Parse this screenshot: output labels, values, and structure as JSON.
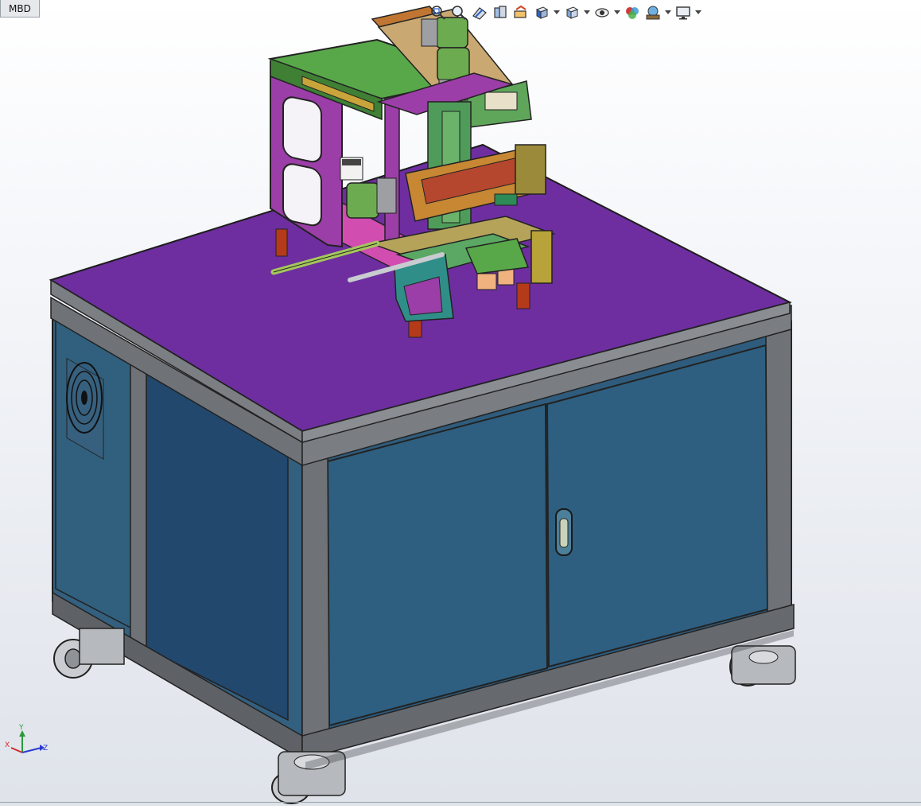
{
  "tabs": {
    "mbd_label": "MBD"
  },
  "toolbar": {
    "buttons": [
      "zoom-to-fit-icon",
      "zoom-to-area-icon",
      "previous-view-icon",
      "section-view-icon",
      "dynamic-annotation-icon",
      "view-orientation-icon",
      "display-style-icon",
      "hide-show-items-icon",
      "edit-appearance-icon",
      "apply-scene-icon",
      "view-settings-icon"
    ]
  },
  "triad": {
    "x_label": "X",
    "y_label": "Y",
    "z_label": "Z"
  },
  "colors": {
    "tabletop": "#6e2ea0",
    "cabinet_panel": "#2c5b7e",
    "frame": "#6f7378",
    "machine_frame": "#9b3ea7",
    "green_plate": "#58a84a"
  }
}
